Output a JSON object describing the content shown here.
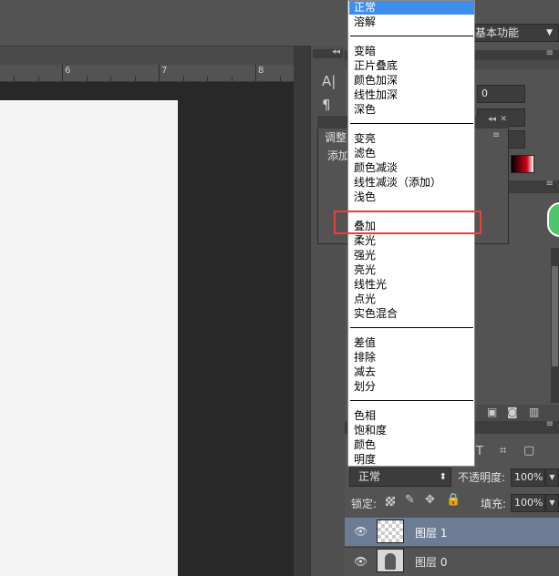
{
  "workspace": {
    "label": "基本功能"
  },
  "ruler": {
    "marks": [
      "6",
      "7",
      "8"
    ]
  },
  "adjust_panel": {
    "title": "调整",
    "add_label": "添加"
  },
  "blend_dropdown": {
    "groups": [
      [
        "正常",
        "溶解"
      ],
      [
        "变暗",
        "正片叠底",
        "颜色加深",
        "线性加深",
        "深色"
      ],
      [
        "变亮",
        "滤色",
        "颜色减淡",
        "线性减淡（添加）",
        "浅色"
      ],
      [
        "叠加",
        "柔光",
        "强光",
        "亮光",
        "线性光",
        "点光",
        "实色混合"
      ],
      [
        "差值",
        "排除",
        "减去",
        "划分"
      ],
      [
        "色相",
        "饱和度",
        "颜色",
        "明度"
      ]
    ],
    "selected": "正常",
    "highlighted": "叠加",
    "accent": "#3e8ef0",
    "highlight_color": "#e8403a"
  },
  "properties": {
    "field_value": "0"
  },
  "layers_panel": {
    "blend_mode": "正常",
    "opacity_label": "不透明度:",
    "opacity_value": "100%",
    "lock_label": "锁定:",
    "fill_label": "填充:",
    "fill_value": "100%",
    "layers": [
      {
        "name": "图层 1",
        "selected": true
      },
      {
        "name": "图层 0",
        "selected": false
      }
    ]
  }
}
